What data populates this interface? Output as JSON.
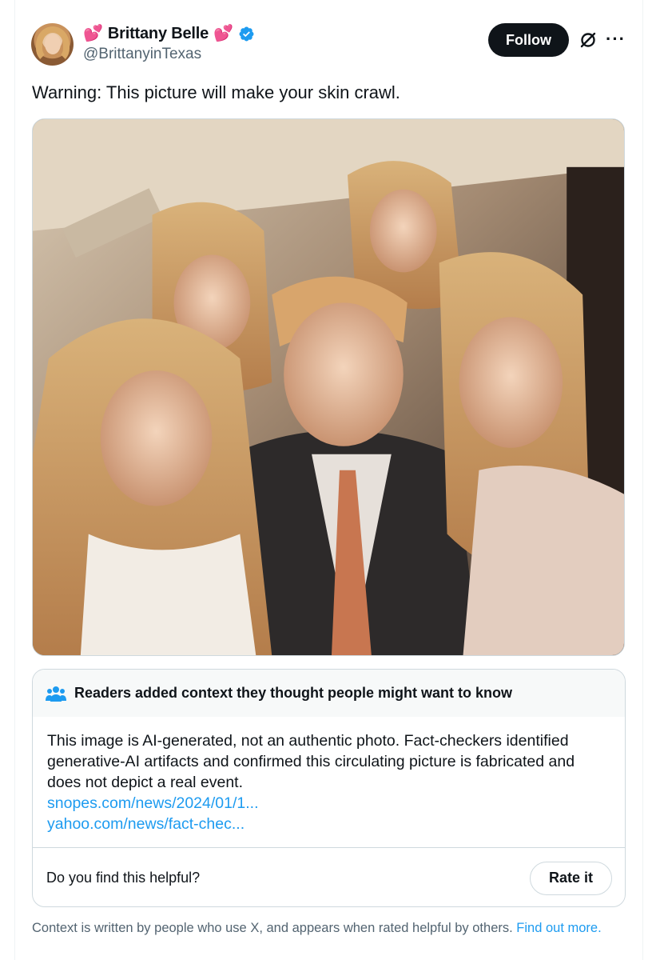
{
  "author": {
    "name": "Brittany Belle",
    "handle": "@BrittanyinTexas",
    "emoji_left": "💕",
    "emoji_right": "💕"
  },
  "actions": {
    "follow_label": "Follow",
    "more_label": "···"
  },
  "tweet": {
    "text": "Warning: This picture will make your skin crawl."
  },
  "note": {
    "title": "Readers added context they thought people might want to know",
    "body": "This image is AI-generated, not an authentic photo. Fact-checkers identified generative-AI artifacts and confirmed this circulating picture is fabricated and does not depict a real event.",
    "links": [
      "snopes.com/news/2024/01/1...",
      "yahoo.com/news/fact-chec..."
    ],
    "helpful_question": "Do you find this helpful?",
    "rate_label": "Rate it"
  },
  "footer": {
    "text": "Context is written by people who use X, and appears when rated helpful by others.",
    "link": "Find out more."
  },
  "colors": {
    "accent": "#1d9bf0",
    "text": "#0f1419",
    "muted": "#536471",
    "border": "#cfd9de",
    "heart": "#e0245e"
  },
  "icons": [
    "verified-badge-icon",
    "grok-icon",
    "more-icon",
    "people-icon",
    "heart-emoji"
  ]
}
